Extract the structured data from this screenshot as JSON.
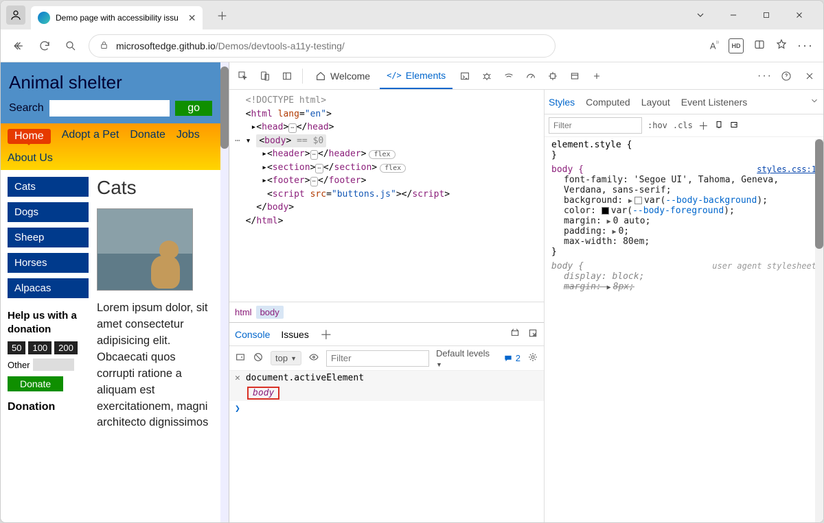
{
  "browser": {
    "tab_title": "Demo page with accessibility issu",
    "url_host": "microsoftedge.github.io",
    "url_path": "/Demos/devtools-a11y-testing/"
  },
  "page": {
    "site_title": "Animal shelter",
    "search_label": "Search",
    "go_label": "go",
    "nav": [
      "Home",
      "Adopt a Pet",
      "Donate",
      "Jobs",
      "About Us"
    ],
    "sidebar_items": [
      "Cats",
      "Dogs",
      "Sheep",
      "Horses",
      "Alpacas"
    ],
    "help_heading": "Help us with a donation",
    "donation_amounts": [
      "50",
      "100",
      "200"
    ],
    "other_label": "Other",
    "donate_label": "Donate",
    "donation_heading": "Donation",
    "main_heading": "Cats",
    "paragraph": "Lorem ipsum dolor, sit amet consectetur adipisicing elit. Obcaecati quos corrupti ratione a aliquam est exercitationem, magni architecto dignissimos"
  },
  "devtools": {
    "tabs": {
      "welcome": "Welcome",
      "elements": "Elements"
    },
    "dom": {
      "doctype": "<!DOCTYPE html>",
      "html_open": "html",
      "html_lang_attr": "lang",
      "html_lang_val": "\"en\"",
      "head": "head",
      "body": "body",
      "sel_hint": "== $0",
      "header": "header",
      "section": "section",
      "footer": "footer",
      "script": "script",
      "script_src_attr": "src",
      "script_src_val": "\"buttons.js\"",
      "flex_pill": "flex"
    },
    "crumbs": [
      "html",
      "body"
    ],
    "styles": {
      "tabs": [
        "Styles",
        "Computed",
        "Layout",
        "Event Listeners"
      ],
      "filter_placeholder": "Filter",
      "hov": ":hov",
      "cls": ".cls",
      "element_style": "element.style {",
      "close_brace": "}",
      "body_sel": "body {",
      "link": "styles.css:1",
      "p1_k": "font-family",
      "p1_v": "'Segoe UI', Tahoma, Geneva, Verdana, sans-serif;",
      "p2_k": "background",
      "p2_v1": "var(",
      "p2_v2": "--body-background",
      "p2_v3": ");",
      "p3_k": "color",
      "p3_v1": "var(",
      "p3_v2": "--body-foreground",
      "p3_v3": ");",
      "p4_k": "margin",
      "p4_v": "0 auto;",
      "p5_k": "padding",
      "p5_v": "0;",
      "p6_k": "max-width",
      "p6_v": "80em;",
      "ua_note": "user agent stylesheet",
      "ua1_k": "display",
      "ua1_v": "block;",
      "ua2_k": "margin",
      "ua2_v": "8px;"
    },
    "drawer": {
      "console": "Console",
      "issues": "Issues",
      "context": "top",
      "filter_placeholder": "Filter",
      "levels": "Default levels",
      "msg_count": "2",
      "log_expr": "document.activeElement",
      "log_result": "body"
    }
  }
}
